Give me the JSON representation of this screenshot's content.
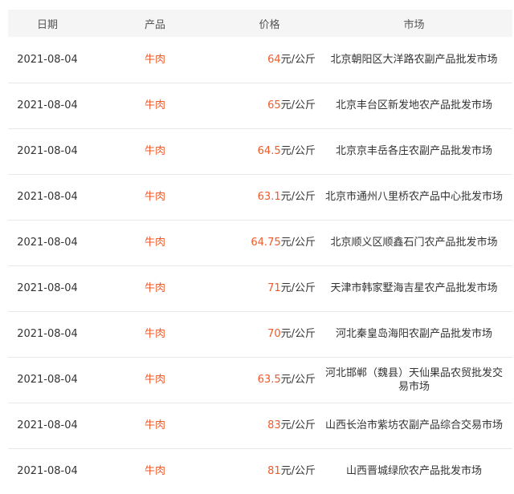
{
  "table": {
    "headers": {
      "date": "日期",
      "product": "产品",
      "price": "价格",
      "market": "市场"
    },
    "rows": [
      {
        "date": "2021-08-04",
        "product": "牛肉",
        "price_value": "64",
        "price_unit": "元/公斤",
        "market": "北京朝阳区大洋路农副产品批发市场"
      },
      {
        "date": "2021-08-04",
        "product": "牛肉",
        "price_value": "65",
        "price_unit": "元/公斤",
        "market": "北京丰台区新发地农产品批发市场"
      },
      {
        "date": "2021-08-04",
        "product": "牛肉",
        "price_value": "64.5",
        "price_unit": "元/公斤",
        "market": "北京京丰岳各庄农副产品批发市场"
      },
      {
        "date": "2021-08-04",
        "product": "牛肉",
        "price_value": "63.1",
        "price_unit": "元/公斤",
        "market": "北京市通州八里桥农产品中心批发市场"
      },
      {
        "date": "2021-08-04",
        "product": "牛肉",
        "price_value": "64.75",
        "price_unit": "元/公斤",
        "market": "北京顺义区顺鑫石门农产品批发市场"
      },
      {
        "date": "2021-08-04",
        "product": "牛肉",
        "price_value": "71",
        "price_unit": "元/公斤",
        "market": "天津市韩家墅海吉星农产品批发市场"
      },
      {
        "date": "2021-08-04",
        "product": "牛肉",
        "price_value": "70",
        "price_unit": "元/公斤",
        "market": "河北秦皇岛海阳农副产品批发市场"
      },
      {
        "date": "2021-08-04",
        "product": "牛肉",
        "price_value": "63.5",
        "price_unit": "元/公斤",
        "market": "河北邯郸（魏县）天仙果品农贸批发交易市场"
      },
      {
        "date": "2021-08-04",
        "product": "牛肉",
        "price_value": "83",
        "price_unit": "元/公斤",
        "market": "山西长治市紫坊农副产品综合交易市场"
      },
      {
        "date": "2021-08-04",
        "product": "牛肉",
        "price_value": "81",
        "price_unit": "元/公斤",
        "market": "山西晋城绿欣农产品批发市场"
      }
    ]
  },
  "colors": {
    "accent": "#f05a28",
    "header_bg": "#f5f5f5",
    "row_divider": "#e8e8e8"
  }
}
